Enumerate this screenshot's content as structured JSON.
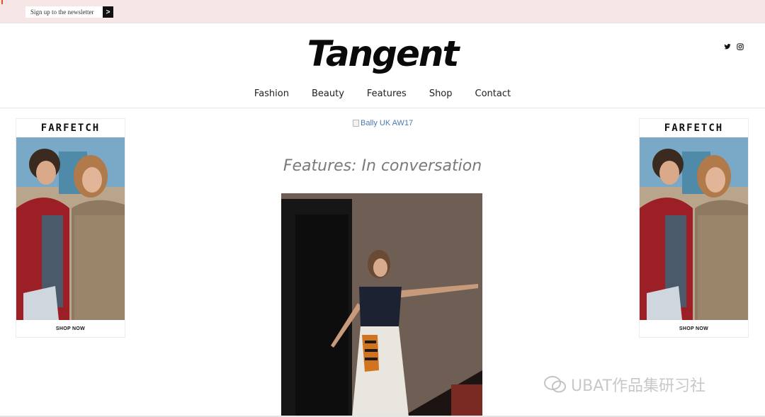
{
  "topbar": {
    "newsletter_label": "Sign up to the newsletter",
    "submit_glyph": ">"
  },
  "header": {
    "logo": "Tangent",
    "social": [
      "twitter-icon",
      "instagram-icon"
    ]
  },
  "nav": {
    "items": [
      "Fashion",
      "Beauty",
      "Features",
      "Shop",
      "Contact"
    ]
  },
  "ads": {
    "left": {
      "brand": "FARFETCH",
      "cta": "SHOP NOW"
    },
    "right": {
      "brand": "FARFETCH",
      "cta": "SHOP NOW"
    }
  },
  "banner": {
    "alt_text": "Bally UK AW17"
  },
  "main": {
    "title": "Features: In conversation"
  },
  "watermark": {
    "text": "UBAT作品集研习社"
  },
  "colors": {
    "topbar": "#f6e6e6",
    "link": "#4a78b5",
    "title": "#7a7a7a"
  }
}
